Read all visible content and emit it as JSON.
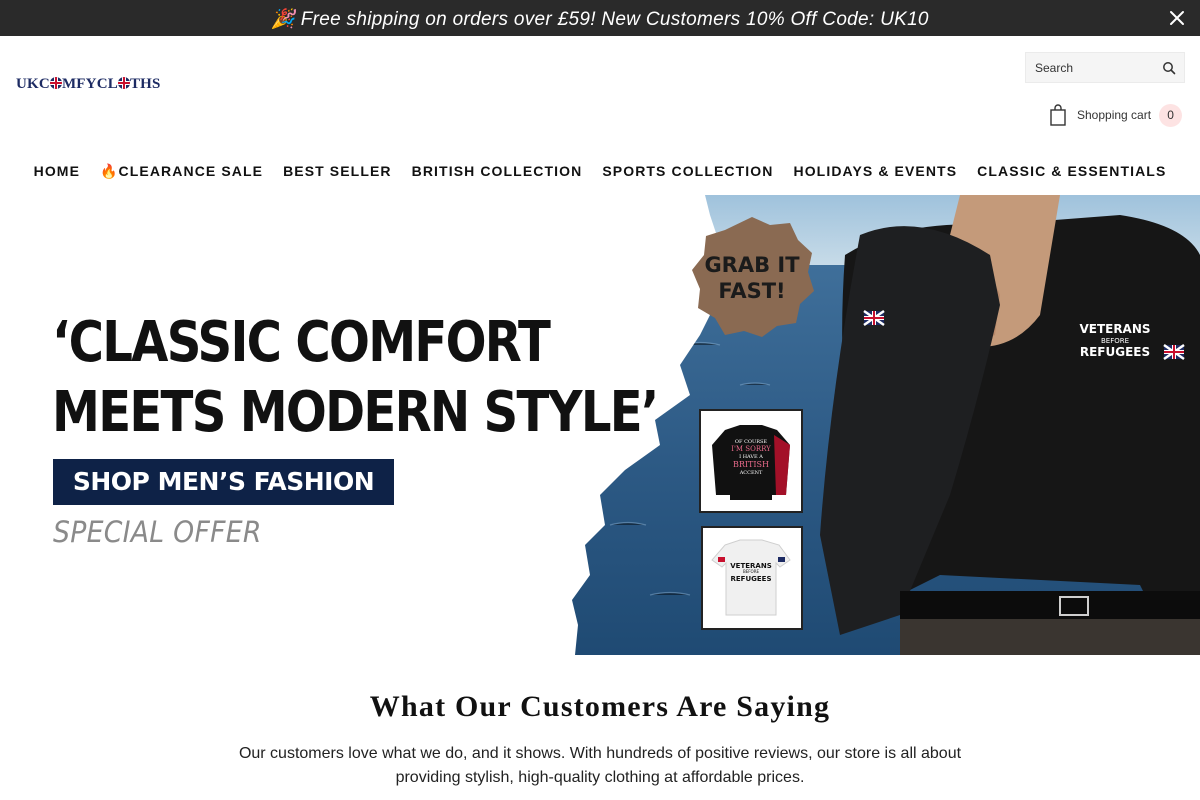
{
  "announcement": {
    "text": "🎉 Free shipping on orders over  £59! New Customers 10% Off Code: UK10"
  },
  "header": {
    "logo_text": "UKCOMFYCLOTHS",
    "search_placeholder": "Search",
    "cart_label": "Shopping cart",
    "cart_count": "0"
  },
  "nav": {
    "items": [
      {
        "label": "HOME"
      },
      {
        "label": "🔥CLEARANCE SALE"
      },
      {
        "label": "BEST SELLER"
      },
      {
        "label": "BRITISH COLLECTION"
      },
      {
        "label": "SPORTS COLLECTION"
      },
      {
        "label": "HOLIDAYS & EVENTS"
      },
      {
        "label": "CLASSIC & ESSENTIALS"
      }
    ]
  },
  "hero": {
    "headline_line1": "‘CLASSIC COMFORT",
    "headline_line2": "MEETS MODERN STYLE’",
    "button_label": "SHOP MEN’S FASHION",
    "special_text": "SPECIAL OFFER",
    "badge_line1": "GRAB IT",
    "badge_line2": "FAST!",
    "shirt_text_line1": "VETERANS",
    "shirt_text_line2": "BEFORE",
    "shirt_text_line3": "REFUGEES",
    "sweater_text_line1": "OF COURSE",
    "sweater_text_line2": "I'M SORRY",
    "sweater_text_line3": "I HAVE A",
    "sweater_text_line4": "BRITISH",
    "sweater_text_line5": "ACCENT"
  },
  "testimonials": {
    "title": "What Our Customers Are Saying",
    "text": "Our customers love what we do, and it shows. With hundreds of positive reviews, our store is all about providing stylish, high-quality clothing at affordable prices."
  },
  "colors": {
    "announcement_bg": "#2a2a2a",
    "brand_navy": "#0e2247",
    "logo": "#1d2b63",
    "badge_brown": "#8a6a52",
    "cart_badge_bg": "#fde3e3"
  },
  "icons": {
    "close": "close-icon",
    "search": "search-icon",
    "cart": "shopping-bag-icon"
  }
}
